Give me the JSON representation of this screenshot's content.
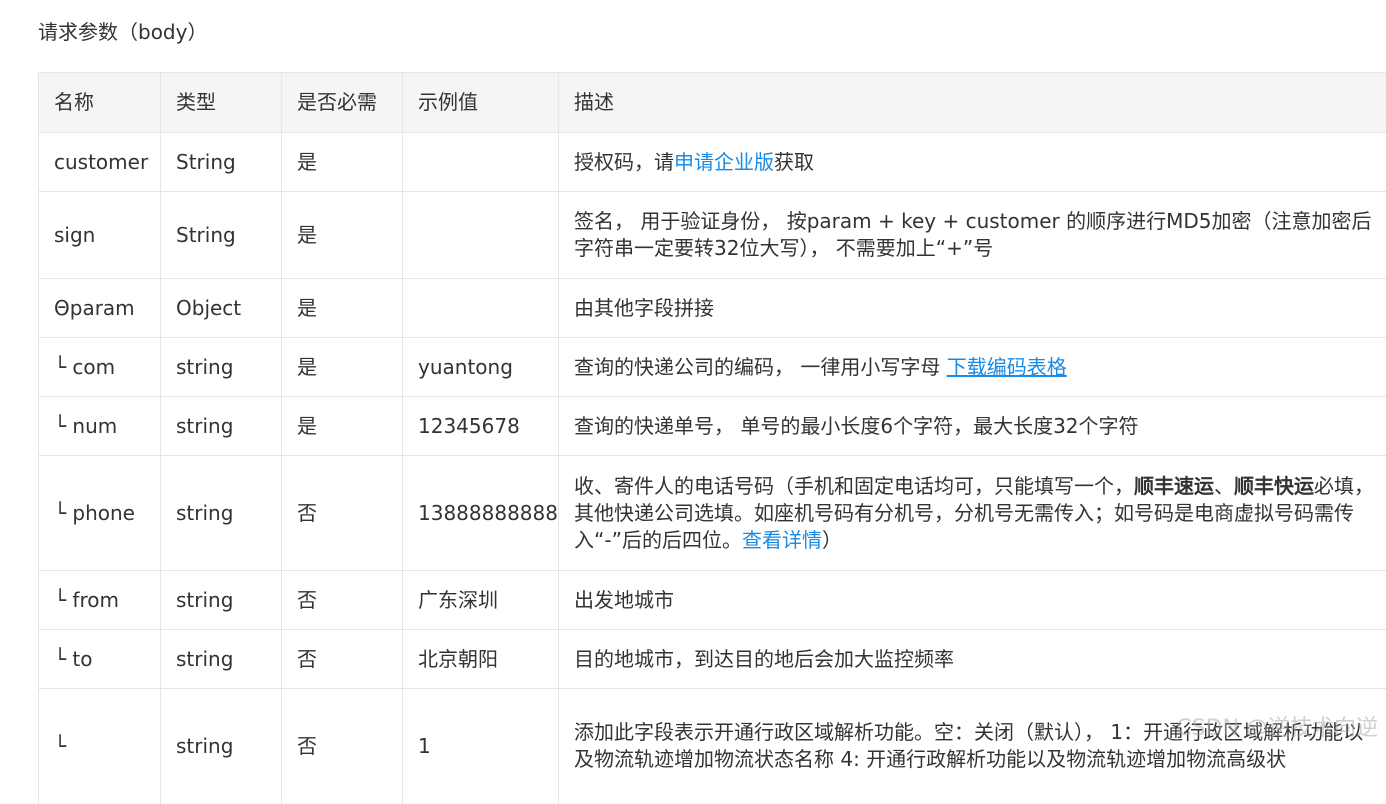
{
  "section_title": "请求参数（body）",
  "headers": [
    "名称",
    "类型",
    "是否必需",
    "示例值",
    "描述"
  ],
  "rows": [
    {
      "name": "customer",
      "type": "String",
      "required": "是",
      "example": "",
      "desc": [
        {
          "text": "授权码，请",
          "style": "plain"
        },
        {
          "text": "申请企业版",
          "style": "link"
        },
        {
          "text": "获取",
          "style": "plain"
        }
      ]
    },
    {
      "name": "sign",
      "type": "String",
      "required": "是",
      "example": "",
      "desc": [
        {
          "text": "签名， 用于验证身份， 按param + key + customer 的顺序进行MD5加密（注意加密后字符串一定要转32位大写）， 不需要加上“+”号",
          "style": "plain"
        }
      ]
    },
    {
      "name": "Θparam",
      "type": "Object",
      "required": "是",
      "example": "",
      "desc": [
        {
          "text": "由其他字段拼接",
          "style": "plain"
        }
      ]
    },
    {
      "name": "└ com",
      "type": "string",
      "required": "是",
      "example": "yuantong",
      "desc": [
        {
          "text": "查询的快递公司的编码， 一律用小写字母 ",
          "style": "plain"
        },
        {
          "text": "下载编码表格",
          "style": "link-underline"
        }
      ]
    },
    {
      "name": "└ num",
      "type": "string",
      "required": "是",
      "example": "12345678",
      "desc": [
        {
          "text": "查询的快递单号， 单号的最小长度6个字符，最大长度32个字符",
          "style": "plain"
        }
      ]
    },
    {
      "name": "└ phone",
      "type": "string",
      "required": "否",
      "example": "13888888888",
      "desc": [
        {
          "text": "收、寄件人的电话号码（手机和固定电话均可，只能填写一个，",
          "style": "plain"
        },
        {
          "text": "顺丰速运",
          "style": "bold"
        },
        {
          "text": "、",
          "style": "plain"
        },
        {
          "text": "顺丰快运",
          "style": "bold"
        },
        {
          "text": "必填，其他快递公司选填。如座机号码有分机号，分机号无需传入；如号码是电商虚拟号码需传入“-”后的后四位。",
          "style": "plain"
        },
        {
          "text": "查看详情",
          "style": "link"
        },
        {
          "text": "）",
          "style": "plain"
        }
      ]
    },
    {
      "name": "└ from",
      "type": "string",
      "required": "否",
      "example": "广东深圳",
      "desc": [
        {
          "text": "出发地城市",
          "style": "plain"
        }
      ]
    },
    {
      "name": "└ to",
      "type": "string",
      "required": "否",
      "example": "北京朝阳",
      "desc": [
        {
          "text": "目的地城市，到达目的地后会加大监控频率",
          "style": "plain"
        }
      ]
    },
    {
      "name": "└",
      "type": "string",
      "required": "否",
      "example": "1",
      "desc": [
        {
          "text": "添加此字段表示开通行政区域解析功能。空：关闭（默认）， 1：开通行政区域解析功能以及物流轨迹增加物流状态名称 4: 开通行政解析功能以及物流轨迹增加物流高级状",
          "style": "plain"
        }
      ]
    }
  ],
  "watermark": "CSDN @逆技术向逆",
  "colors": {
    "link": "#1a8be5",
    "header_bg": "#f5f5f5",
    "border": "#e6e6e6",
    "text": "#333333"
  }
}
